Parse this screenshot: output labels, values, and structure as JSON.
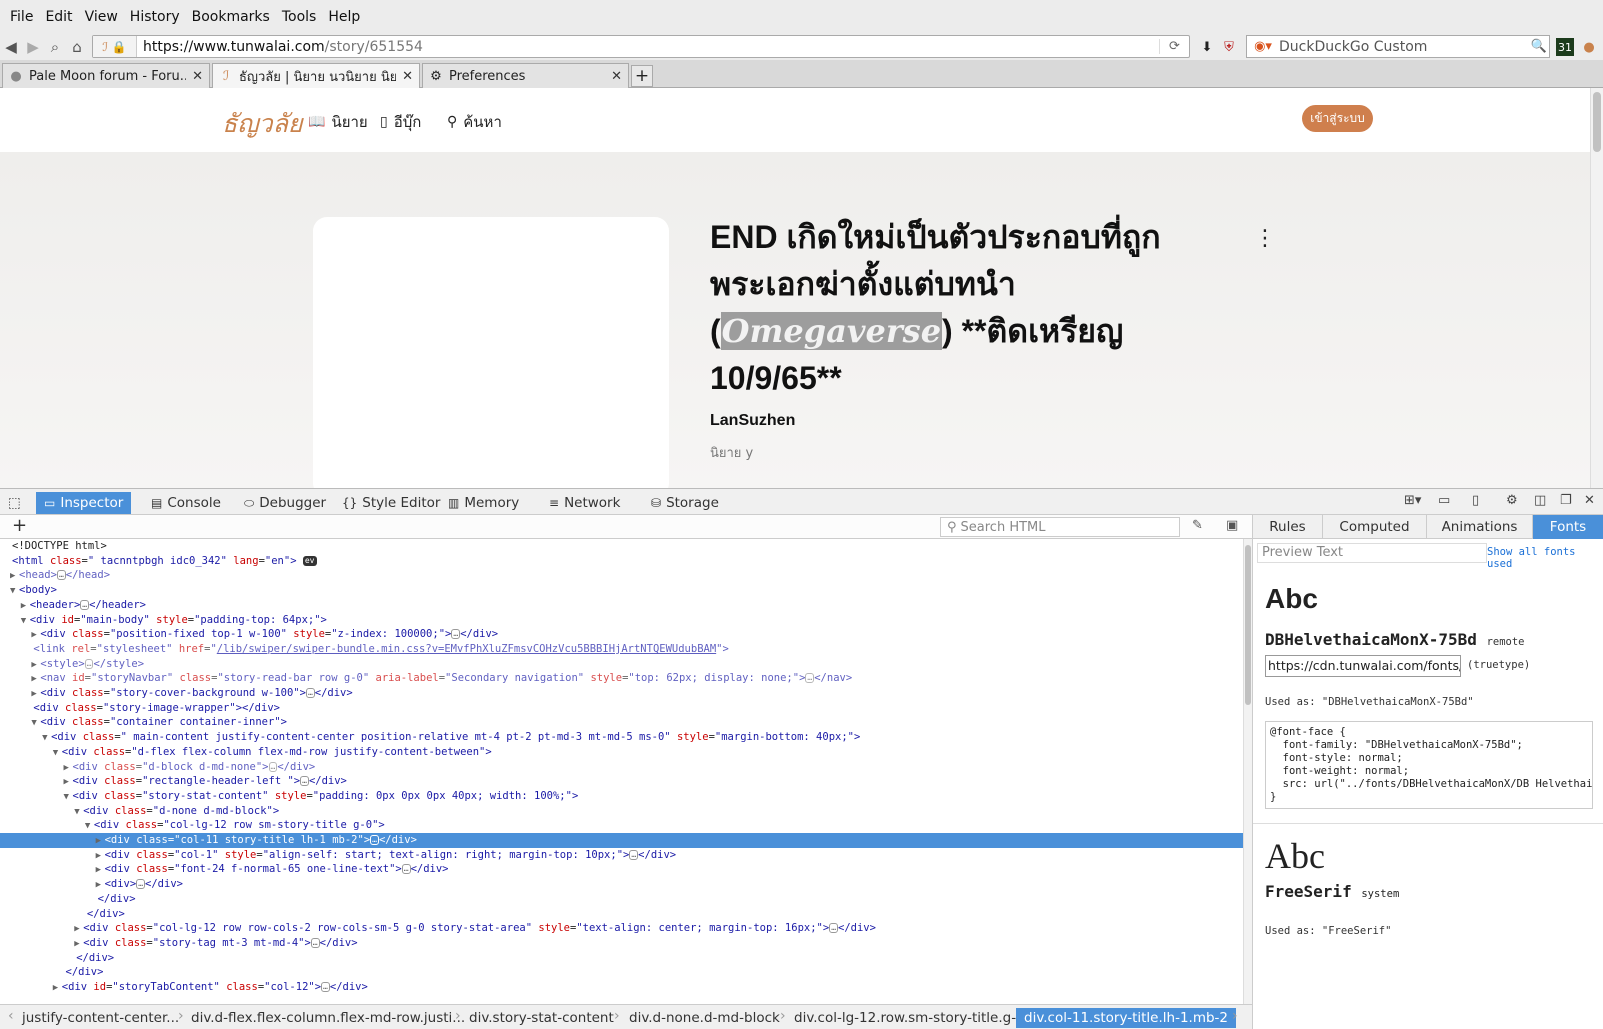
{
  "menu": [
    "File",
    "Edit",
    "View",
    "History",
    "Bookmarks",
    "Tools",
    "Help"
  ],
  "nav": {
    "url_host": "https://www.tunwalai.com",
    "url_path": "/story/651554",
    "search_engine": "DuckDuckGo Custom",
    "calendar_badge": "31"
  },
  "tabs": [
    {
      "title": "Pale Moon forum - Foru..."
    },
    {
      "title": "ธัญวลัย | นิยาย นวนิยาย นิยา..."
    },
    {
      "title": "Preferences"
    }
  ],
  "site": {
    "logo": "ธัญวลัย",
    "nav": [
      "นิยาย",
      "อีบุ๊ก",
      "ค้นหา"
    ],
    "login": "เข้าสู่ระบบ",
    "title_l1": "END เกิดใหม่เป็นตัวประกอบที่ถูก",
    "title_l2": "พระเอกฆ่าตั้งแต่บทนำ",
    "title_l3_pre": "(",
    "title_l3_hl": "Omegaverse",
    "title_l3_post": ") **ติดเหรียญ",
    "title_l4": "10/9/65**",
    "author": "LanSuzhen",
    "genre": "นิยาย y"
  },
  "devtools": {
    "tabs": [
      "Inspector",
      "Console",
      "Debugger",
      "Style Editor",
      "Memory",
      "Network",
      "Storage"
    ],
    "search_placeholder": "Search HTML",
    "side_tabs": [
      "Rules",
      "Computed",
      "Animations",
      "Fonts"
    ],
    "preview_placeholder": "Preview Text",
    "show_all": "Show all fonts used",
    "font1": {
      "sample": "Abc",
      "name": "DBHelvethaicaMonX-75Bd",
      "kind": "remote",
      "url": "https://cdn.tunwalai.com/fonts/",
      "format": "(truetype)",
      "used_as": "Used as: \"DBHelvethaicaMonX-75Bd\"",
      "font_face": "@font-face {\n  font-family: \"DBHelvethaicaMonX-75Bd\";\n  font-style: normal;\n  font-weight: normal;\n  src: url(\"../fonts/DBHelvethaicaMonX/DB Helvethaic…\n}"
    },
    "font2": {
      "sample": "Abc",
      "name": "FreeSerif",
      "kind": "system",
      "used_as": "Used as: \"FreeSerif\""
    },
    "breadcrumbs": [
      "justify-content-center...",
      "div.d-flex.flex-column.flex-md-row.justi...",
      "div.story-stat-content",
      "div.d-none.d-md-block",
      "div.col-lg-12.row.sm-story-title.g-0",
      "div.col-11.story-title.lh-1.mb-2"
    ]
  },
  "markup": [
    {
      "indent": 0,
      "tw": "",
      "html": "&lt;!DOCTYPE html&gt;"
    },
    {
      "indent": 0,
      "tw": "",
      "html": "<span class='tg'>&lt;html</span> <span class='at'>class</span>=<span class='av'>\" tacnntpbgh idc0_342\"</span> <span class='at'>lang</span>=<span class='av'>\"en\"</span><span class='tg'>&gt;</span> <span class='ev'>ev</span>"
    },
    {
      "indent": 0,
      "tw": "▶",
      "html": "<span class='tg dim'>&lt;head&gt;</span><span class='ell'>…</span><span class='tg dim'>&lt;/head&gt;</span>"
    },
    {
      "indent": 0,
      "tw": "▼",
      "html": "<span class='tg'>&lt;body&gt;</span>"
    },
    {
      "indent": 1,
      "tw": "▶",
      "html": "<span class='tg'>&lt;header&gt;</span><span class='ell'>…</span><span class='tg'>&lt;/header&gt;</span>"
    },
    {
      "indent": 1,
      "tw": "▼",
      "html": "<span class='tg'>&lt;div</span> <span class='at'>id</span>=<span class='av'>\"main-body\"</span> <span class='at'>style</span>=<span class='av'>\"padding-top: 64px;\"</span><span class='tg'>&gt;</span>"
    },
    {
      "indent": 2,
      "tw": "▶",
      "html": "<span class='tg'>&lt;div</span> <span class='at'>class</span>=<span class='av'>\"position-fixed top-1 w-100\"</span> <span class='at'>style</span>=<span class='av'>\"z-index: 100000;\"</span><span class='tg'>&gt;</span><span class='ell'>…</span><span class='tg'>&lt;/div&gt;</span>"
    },
    {
      "indent": 2,
      "tw": "",
      "html": "<span class='dim'><span class='tg'>&lt;link</span> <span class='at'>rel</span>=<span class='av'>\"stylesheet\"</span> <span class='at'>href</span>=<span class='av'>\"<span class='link'>/lib/swiper/swiper-bundle.min.css?v=EMvfPhXluZFmsvCOHzVcu5BBBIHjArtNTQEWUdubBAM</span>\"</span><span class='tg'>&gt;</span></span>"
    },
    {
      "indent": 2,
      "tw": "▶",
      "html": "<span class='dim'><span class='tg'>&lt;style&gt;</span><span class='ell'>…</span><span class='tg'>&lt;/style&gt;</span></span>"
    },
    {
      "indent": 2,
      "tw": "▶",
      "html": "<span class='dim'><span class='tg'>&lt;nav</span> <span class='at'>id</span>=<span class='av'>\"storyNavbar\"</span> <span class='at'>class</span>=<span class='av'>\"story-read-bar row g-0\"</span> <span class='at'>aria-label</span>=<span class='av'>\"Secondary navigation\"</span> <span class='at'>style</span>=<span class='av'>\"top: 62px; display: none;\"</span><span class='tg'>&gt;</span><span class='ell'>…</span><span class='tg'>&lt;/nav&gt;</span></span>"
    },
    {
      "indent": 2,
      "tw": "▶",
      "html": "<span class='tg'>&lt;div</span> <span class='at'>class</span>=<span class='av'>\"story-cover-background w-100\"</span><span class='tg'>&gt;</span><span class='ell'>…</span><span class='tg'>&lt;/div&gt;</span>"
    },
    {
      "indent": 2,
      "tw": "",
      "html": "<span class='tg'>&lt;div</span> <span class='at'>class</span>=<span class='av'>\"story-image-wrapper\"</span><span class='tg'>&gt;&lt;/div&gt;</span>"
    },
    {
      "indent": 2,
      "tw": "▼",
      "html": "<span class='tg'>&lt;div</span> <span class='at'>class</span>=<span class='av'>\"container container-inner\"</span><span class='tg'>&gt;</span>"
    },
    {
      "indent": 3,
      "tw": "▼",
      "html": "<span class='tg'>&lt;div</span> <span class='at'>class</span>=<span class='av'>\" main-content justify-content-center position-relative mt-4 pt-2 pt-md-3 mt-md-5 ms-0\"</span> <span class='at'>style</span>=<span class='av'>\"margin-bottom: 40px;\"</span><span class='tg'>&gt;</span>"
    },
    {
      "indent": 4,
      "tw": "▼",
      "html": "<span class='tg'>&lt;div</span> <span class='at'>class</span>=<span class='av'>\"d-flex flex-column flex-md-row justify-content-between\"</span><span class='tg'>&gt;</span>"
    },
    {
      "indent": 5,
      "tw": "▶",
      "html": "<span class='dim'><span class='tg'>&lt;div</span> <span class='at'>class</span>=<span class='av'>\"d-block d-md-none\"</span><span class='tg'>&gt;</span><span class='ell'>…</span><span class='tg'>&lt;/div&gt;</span></span>"
    },
    {
      "indent": 5,
      "tw": "▶",
      "html": "<span class='tg'>&lt;div</span> <span class='at'>class</span>=<span class='av'>\"rectangle-header-left \"</span><span class='tg'>&gt;</span><span class='ell'>…</span><span class='tg'>&lt;/div&gt;</span>"
    },
    {
      "indent": 5,
      "tw": "▼",
      "html": "<span class='tg'>&lt;div</span> <span class='at'>class</span>=<span class='av'>\"story-stat-content\"</span> <span class='at'>style</span>=<span class='av'>\"padding: 0px 0px 0px 40px; width: 100%;\"</span><span class='tg'>&gt;</span>"
    },
    {
      "indent": 6,
      "tw": "▼",
      "html": "<span class='tg'>&lt;div</span> <span class='at'>class</span>=<span class='av'>\"d-none d-md-block\"</span><span class='tg'>&gt;</span>"
    },
    {
      "indent": 7,
      "tw": "▼",
      "html": "<span class='tg'>&lt;div</span> <span class='at'>class</span>=<span class='av'>\"col-lg-12 row sm-story-title g-0\"</span><span class='tg'>&gt;</span>"
    },
    {
      "indent": 8,
      "tw": "▶",
      "sel": true,
      "html": "<span class='tg'>&lt;div</span> <span class='at'>class</span>=<span class='av'>\"col-11 story-title lh-1 mb-2\"</span><span class='tg'>&gt;</span><span class='ell'>…</span><span class='tg'>&lt;/div&gt;</span>"
    },
    {
      "indent": 8,
      "tw": "▶",
      "html": "<span class='tg'>&lt;div</span> <span class='at'>class</span>=<span class='av'>\"col-1\"</span> <span class='at'>style</span>=<span class='av'>\"align-self: start; text-align: right; margin-top: 10px;\"</span><span class='tg'>&gt;</span><span class='ell'>…</span><span class='tg'>&lt;/div&gt;</span>"
    },
    {
      "indent": 8,
      "tw": "▶",
      "html": "<span class='tg'>&lt;div</span> <span class='at'>class</span>=<span class='av'>\"font-24 f-normal-65 one-line-text\"</span><span class='tg'>&gt;</span><span class='ell'>…</span><span class='tg'>&lt;/div&gt;</span>"
    },
    {
      "indent": 8,
      "tw": "▶",
      "html": "<span class='tg'>&lt;div&gt;</span><span class='ell'>…</span><span class='tg'>&lt;/div&gt;</span>"
    },
    {
      "indent": 8,
      "tw": "",
      "html": "<span class='tg'>&lt;/div&gt;</span>"
    },
    {
      "indent": 7,
      "tw": "",
      "html": "<span class='tg'>&lt;/div&gt;</span>"
    },
    {
      "indent": 6,
      "tw": "▶",
      "html": "<span class='tg'>&lt;div</span> <span class='at'>class</span>=<span class='av'>\"col-lg-12 row row-cols-2 row-cols-sm-5 g-0 story-stat-area\"</span> <span class='at'>style</span>=<span class='av'>\"text-align: center; margin-top: 16px;\"</span><span class='tg'>&gt;</span><span class='ell'>…</span><span class='tg'>&lt;/div&gt;</span>"
    },
    {
      "indent": 6,
      "tw": "▶",
      "html": "<span class='tg'>&lt;div</span> <span class='at'>class</span>=<span class='av'>\"story-tag mt-3 mt-md-4\"</span><span class='tg'>&gt;</span><span class='ell'>…</span><span class='tg'>&lt;/div&gt;</span>"
    },
    {
      "indent": 6,
      "tw": "",
      "html": "<span class='tg'>&lt;/div&gt;</span>"
    },
    {
      "indent": 5,
      "tw": "",
      "html": "<span class='tg'>&lt;/div&gt;</span>"
    },
    {
      "indent": 4,
      "tw": "▶",
      "html": "<span class='tg'>&lt;div</span> <span class='at'>id</span>=<span class='av'>\"storyTabContent\"</span> <span class='at'>class</span>=<span class='av'>\"col-12\"</span><span class='tg'>&gt;</span><span class='ell'>…</span><span class='tg'>&lt;/div&gt;</span>"
    }
  ]
}
